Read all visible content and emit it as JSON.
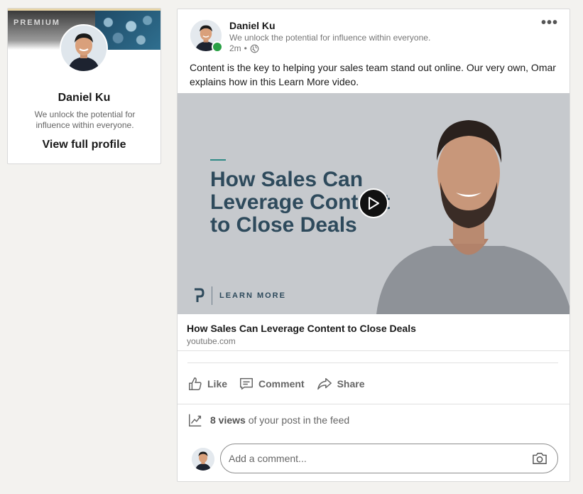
{
  "profile_card": {
    "badge": "PREMIUM",
    "name": "Daniel Ku",
    "tagline": "We unlock the potential for influence within everyone.",
    "view_profile": "View full profile"
  },
  "post": {
    "author": {
      "name": "Daniel Ku",
      "tagline": "We unlock the potential for influence within everyone.",
      "time": "2m",
      "visibility_icon": "globe-icon",
      "online": true
    },
    "text": "Content is the key to helping your sales team stand out online. Our very own, Omar explains how in this Learn More video.",
    "video": {
      "title_line1": "How Sales Can",
      "title_line2": "Leverage Content",
      "title_line3": "to Close Deals",
      "brand_text": "LEARN MORE"
    },
    "link": {
      "title": "How Sales Can Leverage Content to Close Deals",
      "domain": "youtube.com"
    },
    "actions": {
      "like": "Like",
      "comment": "Comment",
      "share": "Share"
    },
    "views": {
      "count_text": "8 views",
      "suffix": " of your post in the feed"
    },
    "comment": {
      "placeholder": "Add a comment..."
    }
  },
  "colors": {
    "online": "#29a045",
    "video_background": "#c6c9cd",
    "video_title": "#2e4a5c"
  }
}
